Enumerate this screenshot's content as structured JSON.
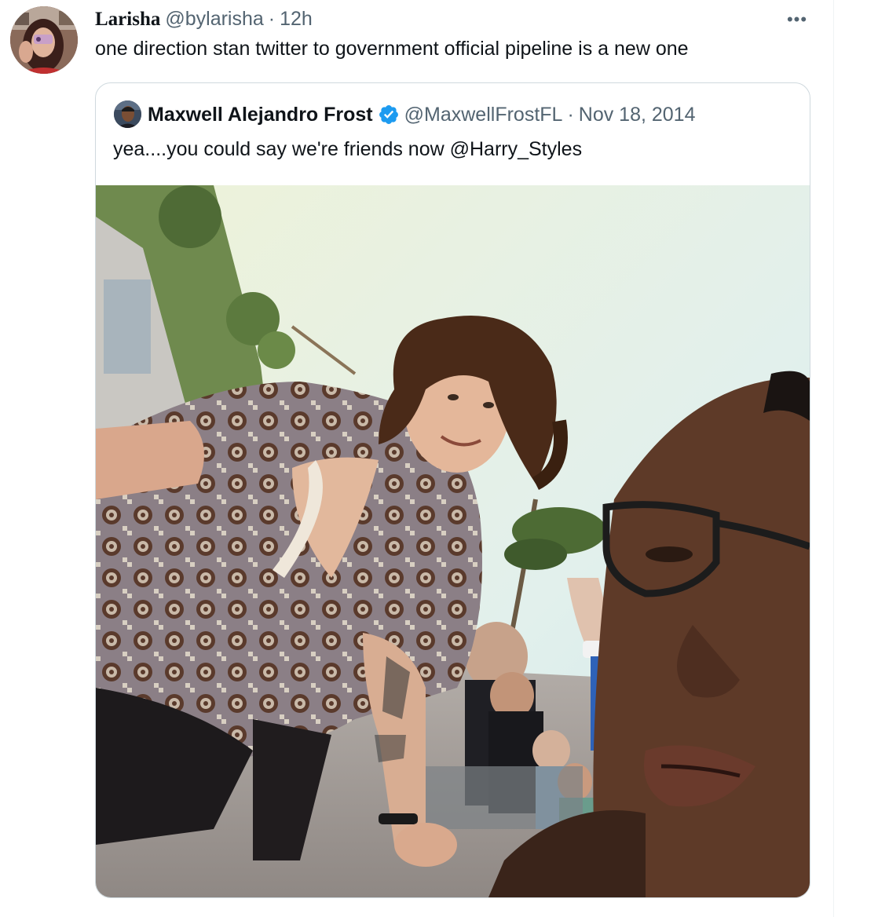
{
  "tweet": {
    "display_name": "Larisha",
    "handle": "@bylarisha",
    "separator": "·",
    "time": "12h",
    "more_label": "•••",
    "text": "one direction stan twitter to government official pipeline is a new one"
  },
  "quoted_tweet": {
    "display_name": "Maxwell Alejandro Frost",
    "handle": "@MaxwellFrostFL",
    "separator": "·",
    "date": "Nov 18, 2014",
    "text": "yea....you could say we're friends now @Harry_Styles",
    "verified": true
  },
  "icons": {
    "avatar": "avatar-image",
    "more": "more-horizontal-icon",
    "verified": "verified-badge-icon",
    "photo": "selfie-photo"
  },
  "colors": {
    "text_primary": "#0f1419",
    "text_secondary": "#536471",
    "border": "#cfd9de",
    "verified_blue": "#1d9bf0"
  }
}
